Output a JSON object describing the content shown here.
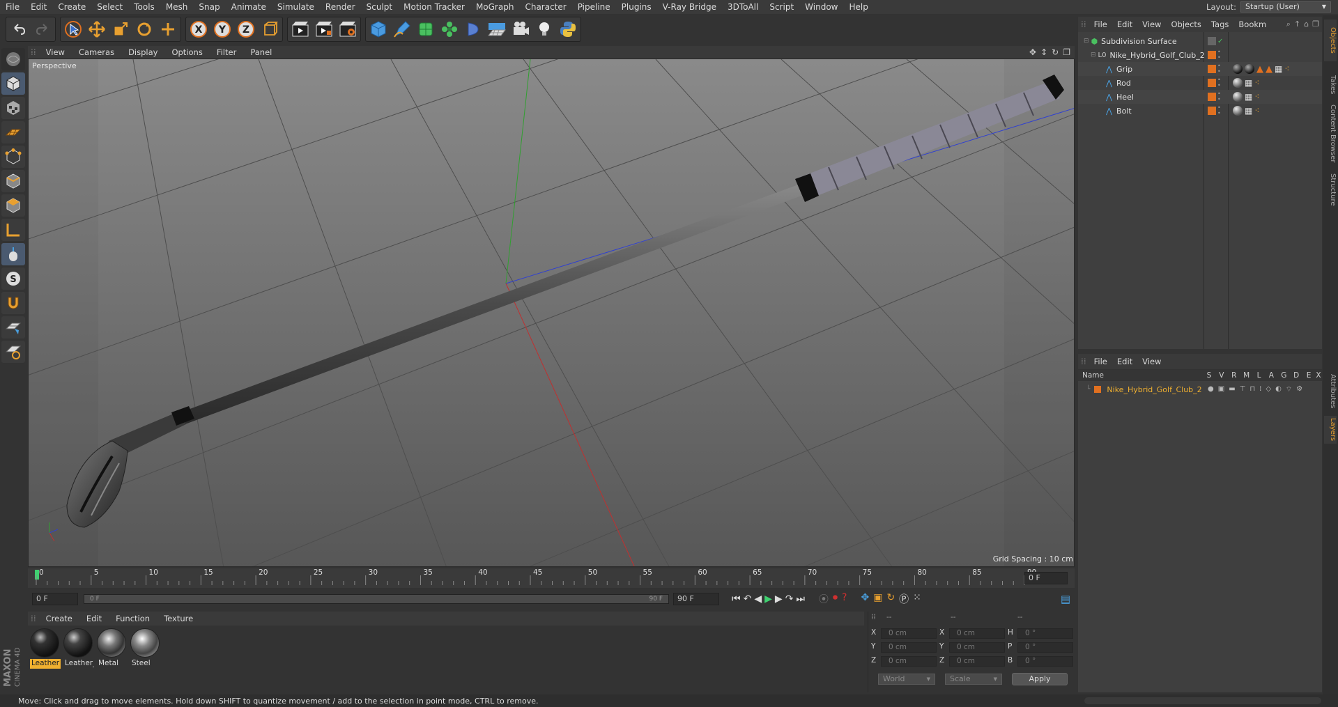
{
  "menubar": {
    "items": [
      "File",
      "Edit",
      "Create",
      "Select",
      "Tools",
      "Mesh",
      "Snap",
      "Animate",
      "Simulate",
      "Render",
      "Sculpt",
      "Motion Tracker",
      "MoGraph",
      "Character",
      "Pipeline",
      "Plugins",
      "V-Ray Bridge",
      "3DToAll",
      "Script",
      "Window",
      "Help"
    ],
    "layout_label": "Layout:",
    "layout_value": "Startup (User)"
  },
  "main_toolbar": {
    "icons": [
      "undo-icon",
      "redo-icon",
      "select-icon",
      "move-icon",
      "scale-icon",
      "rotate-icon",
      "move-plus-icon",
      "x-axis-icon",
      "y-axis-icon",
      "z-axis-icon",
      "coordinate-system-icon",
      "render-view-icon",
      "render-picture-viewer-icon",
      "render-settings-icon",
      "cube-icon",
      "pen-icon",
      "subdivision-icon",
      "cloner-icon",
      "deformer-icon",
      "floor-icon",
      "camera-icon",
      "light-icon",
      "python-icon"
    ],
    "axis_labels": [
      "X",
      "Y",
      "Z"
    ]
  },
  "viewport": {
    "menu": [
      "View",
      "Cameras",
      "Display",
      "Options",
      "Filter",
      "Panel"
    ],
    "label": "Perspective",
    "grid_spacing": "Grid Spacing : 10 cm"
  },
  "timeline": {
    "ticks": [
      "0",
      "5",
      "10",
      "15",
      "20",
      "25",
      "30",
      "35",
      "40",
      "45",
      "50",
      "55",
      "60",
      "65",
      "70",
      "75",
      "80",
      "85",
      "90"
    ],
    "current_frame": "0 F",
    "start_field": "0 F",
    "range_start": "0 F",
    "range_end": "90 F",
    "end_field": "90 F"
  },
  "material_manager": {
    "menu": [
      "Create",
      "Edit",
      "Function",
      "Texture"
    ],
    "materials": [
      {
        "name": "Leather",
        "selected": true
      },
      {
        "name": "Leather_",
        "selected": false
      },
      {
        "name": "Metal",
        "selected": false
      },
      {
        "name": "Steel",
        "selected": false
      }
    ]
  },
  "coordinates": {
    "headers": [
      "--",
      "--",
      "--"
    ],
    "rows": [
      {
        "a": "X",
        "av": "0 cm",
        "b": "X",
        "bv": "0 cm",
        "c": "H",
        "cv": "0 °"
      },
      {
        "a": "Y",
        "av": "0 cm",
        "b": "Y",
        "bv": "0 cm",
        "c": "P",
        "cv": "0 °"
      },
      {
        "a": "Z",
        "av": "0 cm",
        "b": "Z",
        "bv": "0 cm",
        "c": "B",
        "cv": "0 °"
      }
    ],
    "mode1": "World",
    "mode2": "Scale",
    "apply": "Apply"
  },
  "object_manager": {
    "menu": [
      "File",
      "Edit",
      "View",
      "Objects",
      "Tags",
      "Bookm"
    ],
    "objects": [
      {
        "name": "Subdivision Surface",
        "depth": 0
      },
      {
        "name": "Nike_Hybrid_Golf_Club_2",
        "depth": 1
      },
      {
        "name": "Grip",
        "depth": 2
      },
      {
        "name": "Rod",
        "depth": 2
      },
      {
        "name": "Heel",
        "depth": 2
      },
      {
        "name": "Bolt",
        "depth": 2
      }
    ]
  },
  "layer_manager": {
    "menu": [
      "File",
      "Edit",
      "View"
    ],
    "columns": [
      "Name",
      "S",
      "V",
      "R",
      "M",
      "L",
      "A",
      "G",
      "D",
      "E",
      "X"
    ],
    "layers": [
      {
        "name": "Nike_Hybrid_Golf_Club_2"
      }
    ]
  },
  "side_tabs": [
    "Objects",
    "Takes",
    "Content Browser",
    "Structure",
    "Attributes",
    "Layers"
  ],
  "statusbar": {
    "text": "Move: Click and drag to move elements. Hold down SHIFT to quantize movement / add to the selection in point mode, CTRL to remove."
  },
  "brand": {
    "line1": "MAXON",
    "line2": "CINEMA 4D"
  },
  "colors": {
    "accent": "#e07020",
    "selection": "#f0b030",
    "x_axis": "#c03030",
    "y_axis": "#30a030",
    "z_axis": "#3040d0"
  }
}
